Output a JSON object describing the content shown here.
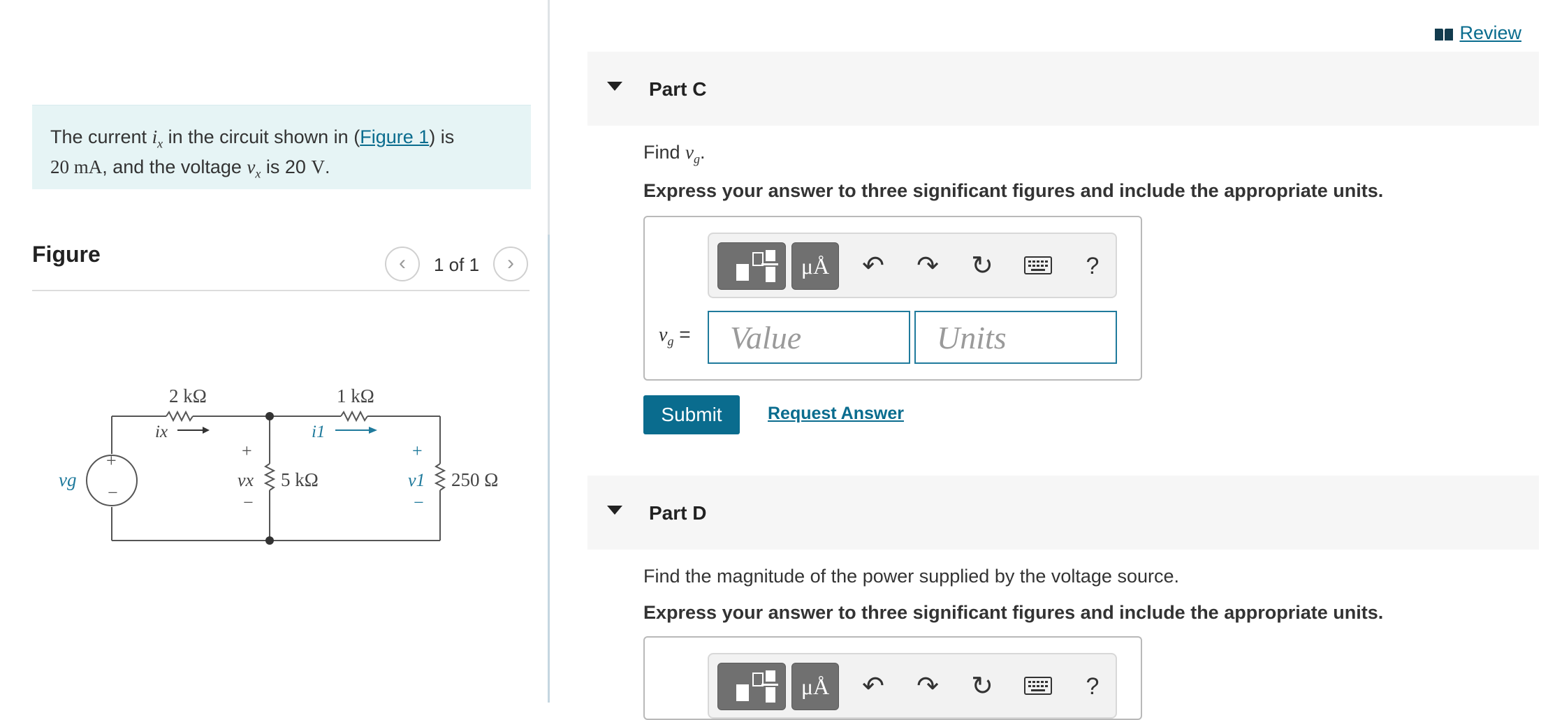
{
  "problem": {
    "text_before_ix": "The current ",
    "ix_symbol": "ix",
    "text_after_ix": " in the circuit shown in (",
    "figure_link": "Figure 1",
    "text_after_link": ") is",
    "current_value": "20 mA",
    "text_mid": ", and the voltage ",
    "vx_symbol": "vx",
    "text_is": " is 20 ",
    "voltage_unit": "V",
    "text_end": "."
  },
  "figure": {
    "title": "Figure",
    "counter": "1 of 1",
    "prev_icon": "chevron-left-icon",
    "next_icon": "chevron-right-icon",
    "circuit_labels": {
      "r1": "2 kΩ",
      "r2": "1 kΩ",
      "r3": "5 kΩ",
      "r4": "250 Ω",
      "source": "vg",
      "ix": "ix",
      "i1": "i1",
      "vx": "vx",
      "v1": "v1",
      "plus": "+",
      "minus": "−"
    }
  },
  "review": {
    "label": "Review",
    "icon": "book-icon"
  },
  "partC": {
    "title": "Part C",
    "find_prefix": "Find ",
    "find_symbol": "vg",
    "find_suffix": ".",
    "express": "Express your answer to three significant figures and include the appropriate units.",
    "answer_label": "vg =",
    "value_placeholder": "Value",
    "units_placeholder": "Units",
    "submit": "Submit",
    "request_answer": "Request Answer"
  },
  "partD": {
    "title": "Part D",
    "find": "Find the magnitude of the power supplied by the voltage source.",
    "express": "Express your answer to three significant figures and include the appropriate units."
  },
  "toolbar": {
    "units_button": "μÅ",
    "help": "?",
    "icons": [
      "templates-icon",
      "units-icon",
      "undo-icon",
      "redo-icon",
      "reset-icon",
      "keyboard-icon",
      "help-icon"
    ]
  },
  "colors": {
    "link": "#0a6c8e",
    "problem_bg": "#e6f4f5",
    "submit_bg": "#0a6c8e",
    "input_border": "#1f7a9c"
  }
}
